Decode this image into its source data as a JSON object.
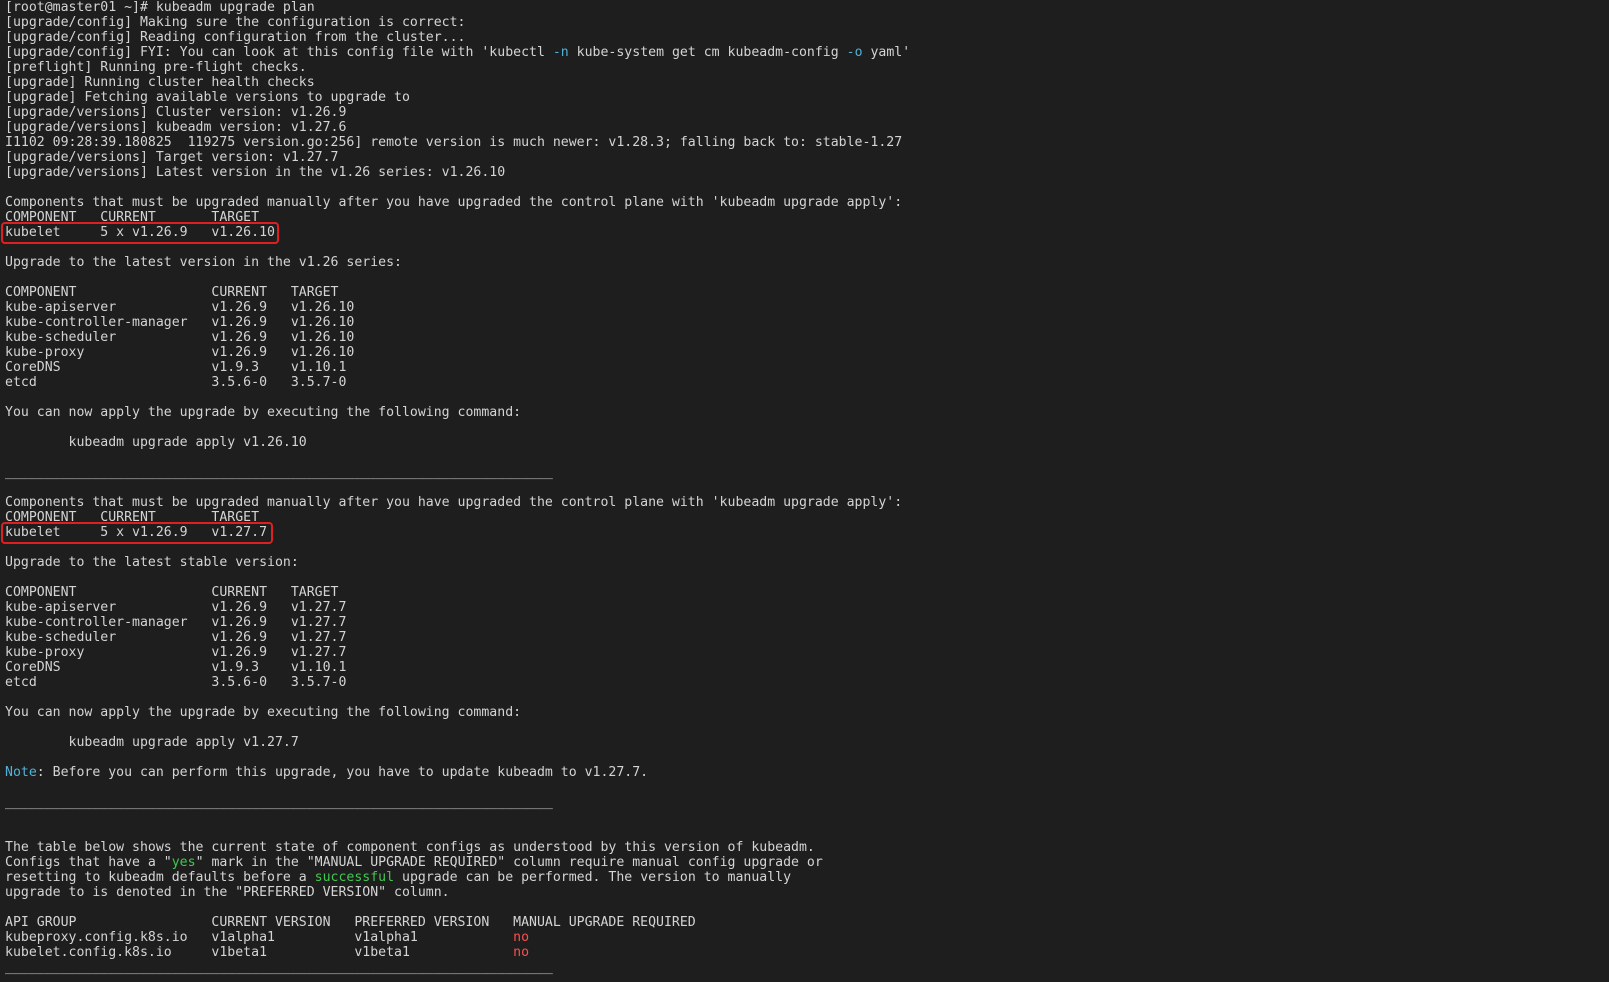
{
  "terminal": {
    "lines": [
      [
        {
          "t": "[root@master01 ~]# kubeadm upgrade plan"
        }
      ],
      [
        {
          "t": "[upgrade/config] Making sure the configuration is correct:"
        }
      ],
      [
        {
          "t": "[upgrade/config] Reading configuration from the cluster..."
        }
      ],
      [
        {
          "t": "[upgrade/config] FYI: You can look at this config file with 'kubectl "
        },
        {
          "t": "-n",
          "c": "cyan"
        },
        {
          "t": " kube-system get cm kubeadm-config "
        },
        {
          "t": "-o",
          "c": "cyan"
        },
        {
          "t": " yaml'"
        }
      ],
      [
        {
          "t": "[preflight] Running pre-flight checks."
        }
      ],
      [
        {
          "t": "[upgrade] Running cluster health checks"
        }
      ],
      [
        {
          "t": "[upgrade] Fetching available versions to upgrade to"
        }
      ],
      [
        {
          "t": "[upgrade/versions] Cluster version: v1.26.9"
        }
      ],
      [
        {
          "t": "[upgrade/versions] kubeadm version: v1.27.6"
        }
      ],
      [
        {
          "t": "I1102 09:28:39.180825  119275 version.go:256] remote version is much newer: v1.28.3; falling back to: stable-1.27"
        }
      ],
      [
        {
          "t": "[upgrade/versions] Target version: v1.27.7"
        }
      ],
      [
        {
          "t": "[upgrade/versions] Latest version in the v1.26 series: v1.26.10"
        }
      ],
      [
        {
          "t": ""
        }
      ],
      [
        {
          "t": "Components that must be upgraded manually after you have upgraded the control plane with 'kubeadm upgrade apply':"
        }
      ],
      [
        {
          "t": "COMPONENT   CURRENT       TARGET"
        }
      ],
      [
        {
          "t": "kubelet     5 x v1.26.9   v1.26.10"
        }
      ],
      [
        {
          "t": ""
        }
      ],
      [
        {
          "t": "Upgrade to the latest version in the v1.26 series:"
        }
      ],
      [
        {
          "t": ""
        }
      ],
      [
        {
          "t": "COMPONENT                 CURRENT   TARGET"
        }
      ],
      [
        {
          "t": "kube-apiserver            v1.26.9   v1.26.10"
        }
      ],
      [
        {
          "t": "kube-controller-manager   v1.26.9   v1.26.10"
        }
      ],
      [
        {
          "t": "kube-scheduler            v1.26.9   v1.26.10"
        }
      ],
      [
        {
          "t": "kube-proxy                v1.26.9   v1.26.10"
        }
      ],
      [
        {
          "t": "CoreDNS                   v1.9.3    v1.10.1"
        }
      ],
      [
        {
          "t": "etcd                      3.5.6-0   3.5.7-0"
        }
      ],
      [
        {
          "t": ""
        }
      ],
      [
        {
          "t": "You can now apply the upgrade by executing the following command:"
        }
      ],
      [
        {
          "t": ""
        }
      ],
      [
        {
          "t": "        kubeadm upgrade apply v1.26.10"
        }
      ],
      [
        {
          "t": ""
        }
      ],
      [
        {
          "t": "_____________________________________________________________________"
        }
      ],
      [
        {
          "t": ""
        }
      ],
      [
        {
          "t": "Components that must be upgraded manually after you have upgraded the control plane with 'kubeadm upgrade apply':"
        }
      ],
      [
        {
          "t": "COMPONENT   CURRENT       TARGET"
        }
      ],
      [
        {
          "t": "kubelet     5 x v1.26.9   v1.27.7"
        }
      ],
      [
        {
          "t": ""
        }
      ],
      [
        {
          "t": "Upgrade to the latest stable version:"
        }
      ],
      [
        {
          "t": ""
        }
      ],
      [
        {
          "t": "COMPONENT                 CURRENT   TARGET"
        }
      ],
      [
        {
          "t": "kube-apiserver            v1.26.9   v1.27.7"
        }
      ],
      [
        {
          "t": "kube-controller-manager   v1.26.9   v1.27.7"
        }
      ],
      [
        {
          "t": "kube-scheduler            v1.26.9   v1.27.7"
        }
      ],
      [
        {
          "t": "kube-proxy                v1.26.9   v1.27.7"
        }
      ],
      [
        {
          "t": "CoreDNS                   v1.9.3    v1.10.1"
        }
      ],
      [
        {
          "t": "etcd                      3.5.6-0   3.5.7-0"
        }
      ],
      [
        {
          "t": ""
        }
      ],
      [
        {
          "t": "You can now apply the upgrade by executing the following command:"
        }
      ],
      [
        {
          "t": ""
        }
      ],
      [
        {
          "t": "        kubeadm upgrade apply v1.27.7"
        }
      ],
      [
        {
          "t": ""
        }
      ],
      [
        {
          "t": "Note",
          "c": "cyan"
        },
        {
          "t": ": Before you can perform this upgrade, you have to update kubeadm to v1.27.7."
        }
      ],
      [
        {
          "t": ""
        }
      ],
      [
        {
          "t": "_____________________________________________________________________"
        }
      ],
      [
        {
          "t": ""
        }
      ],
      [
        {
          "t": ""
        }
      ],
      [
        {
          "t": "The table below shows the current state of component configs as understood by this version of kubeadm."
        }
      ],
      [
        {
          "t": "Configs that have a \""
        },
        {
          "t": "yes",
          "c": "green"
        },
        {
          "t": "\" mark in the \"MANUAL UPGRADE REQUIRED\" column require manual config upgrade or"
        }
      ],
      [
        {
          "t": "resetting to kubeadm defaults before a "
        },
        {
          "t": "successful",
          "c": "green"
        },
        {
          "t": " upgrade can be performed. The version to manually"
        }
      ],
      [
        {
          "t": "upgrade to is denoted in the \"PREFERRED VERSION\" column."
        }
      ],
      [
        {
          "t": ""
        }
      ],
      [
        {
          "t": "API GROUP                 CURRENT VERSION   PREFERRED VERSION   MANUAL UPGRADE REQUIRED"
        }
      ],
      [
        {
          "t": "kubeproxy.config.k8s.io   v1alpha1          v1alpha1            "
        },
        {
          "t": "no",
          "c": "red"
        }
      ],
      [
        {
          "t": "kubelet.config.k8s.io     v1beta1           v1beta1             "
        },
        {
          "t": "no",
          "c": "red"
        }
      ],
      [
        {
          "t": "_____________________________________________________________________"
        }
      ]
    ]
  },
  "colors": {
    "background": "#1e1e1e",
    "text": "#d4d4d4",
    "cyan": "#4fb3d9",
    "green": "#3fc94f",
    "red": "#ff4d4d",
    "highlight_box": "#e02020"
  }
}
